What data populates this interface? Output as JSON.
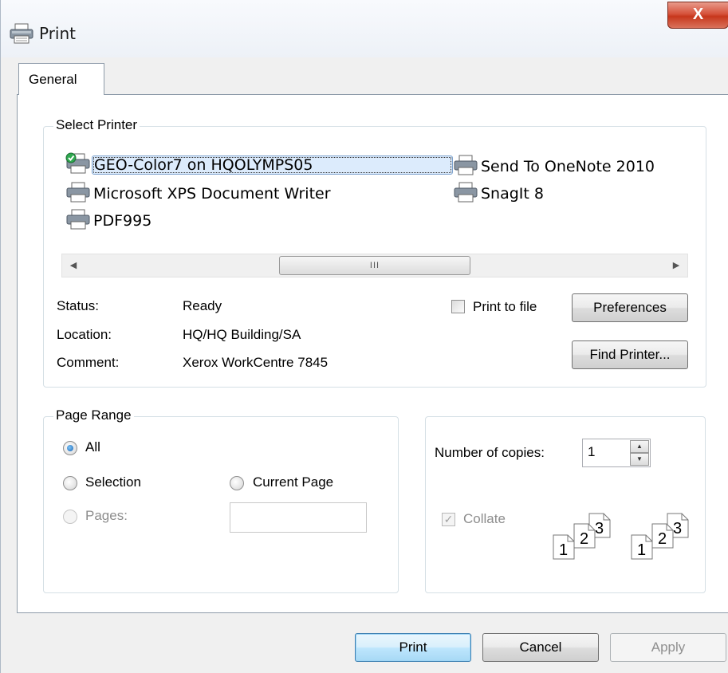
{
  "window": {
    "title": "Print",
    "close_glyph": "X"
  },
  "tabs": [
    {
      "label": "General"
    }
  ],
  "select_printer": {
    "title": "Select Printer",
    "printers": [
      {
        "name": "GEO-Color7 on HQOLYMPS05",
        "icon": "printer-default-icon",
        "selected": true
      },
      {
        "name": "Microsoft XPS Document Writer",
        "icon": "printer-icon"
      },
      {
        "name": "PDF995",
        "icon": "printer-icon"
      },
      {
        "name": "Send To OneNote 2010",
        "icon": "printer-icon"
      },
      {
        "name": "SnagIt 8",
        "icon": "printer-icon"
      }
    ],
    "scroll_left": "◀",
    "scroll_thumb": "III",
    "scroll_right": "▶",
    "status_label": "Status:",
    "status_value": "Ready",
    "location_label": "Location:",
    "location_value": "HQ/HQ Building/SA",
    "comment_label": "Comment:",
    "comment_value": "Xerox WorkCentre 7845",
    "print_to_file": "Print to file",
    "preferences": "Preferences",
    "find_printer": "Find Printer..."
  },
  "page_range": {
    "title": "Page Range",
    "all": "All",
    "selection": "Selection",
    "current_page": "Current Page",
    "pages": "Pages:",
    "pages_value": ""
  },
  "copies": {
    "label": "Number of copies:",
    "value": "1",
    "collate": "Collate",
    "collate_pages": [
      "1",
      "2",
      "3",
      "1",
      "2",
      "3"
    ]
  },
  "buttons": {
    "print": "Print",
    "cancel": "Cancel",
    "apply": "Apply"
  },
  "colors": {
    "selection_bg": "#dcebfc",
    "close_red": "#c7371c",
    "default_button": "#3c7fb1"
  }
}
